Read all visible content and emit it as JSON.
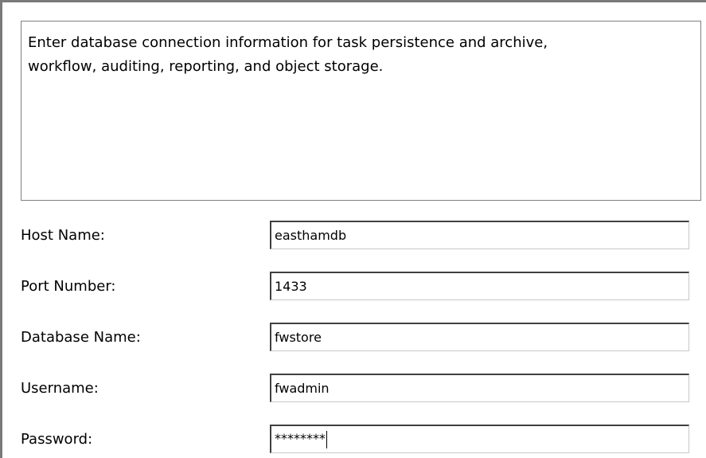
{
  "description": {
    "line1": "Enter database connection information for task persistence and archive,",
    "line2": "workflow, auditing, reporting, and object storage."
  },
  "fields": [
    {
      "label": "Host Name:",
      "value": "easthamdb"
    },
    {
      "label": "Port Number:",
      "value": "1433"
    },
    {
      "label": "Database Name:",
      "value": "fwstore"
    },
    {
      "label": "Username:",
      "value": "fwadmin"
    },
    {
      "label": "Password:",
      "value": "********"
    }
  ]
}
